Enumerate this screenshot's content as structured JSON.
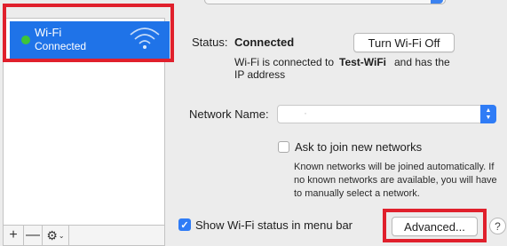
{
  "network_list": {
    "items": [
      {
        "title": "Wi-Fi",
        "status": "Connected",
        "icon": "wifi-icon",
        "dot_color": "#3ec438"
      }
    ],
    "selected_color": "#1f73e8"
  },
  "toolbar": {
    "add_label": "+",
    "remove_label": "—",
    "gear_icon": "gear-icon",
    "gear_chevron": "⌄"
  },
  "status": {
    "label": "Status:",
    "value": "Connected",
    "turn_off_button": "Turn Wi-Fi Off",
    "description_part1": "Wi-Fi is connected to",
    "ssid": "Test-WiFi",
    "description_part2": "and has the",
    "description_line2": "IP address"
  },
  "network_name": {
    "label": "Network Name:",
    "value": "·"
  },
  "ask_to_join": {
    "checked": false,
    "label": "Ask to join new networks",
    "help_lines": [
      "Known networks will be joined automatically. If",
      "no known networks are available, you will have",
      "to manually select a network."
    ]
  },
  "show_status": {
    "checked": true,
    "label": "Show Wi-Fi status in menu bar"
  },
  "advanced_button": "Advanced...",
  "help_button": "?",
  "colors": {
    "accent": "#2f7cf6",
    "highlight_border": "#e0202c"
  }
}
